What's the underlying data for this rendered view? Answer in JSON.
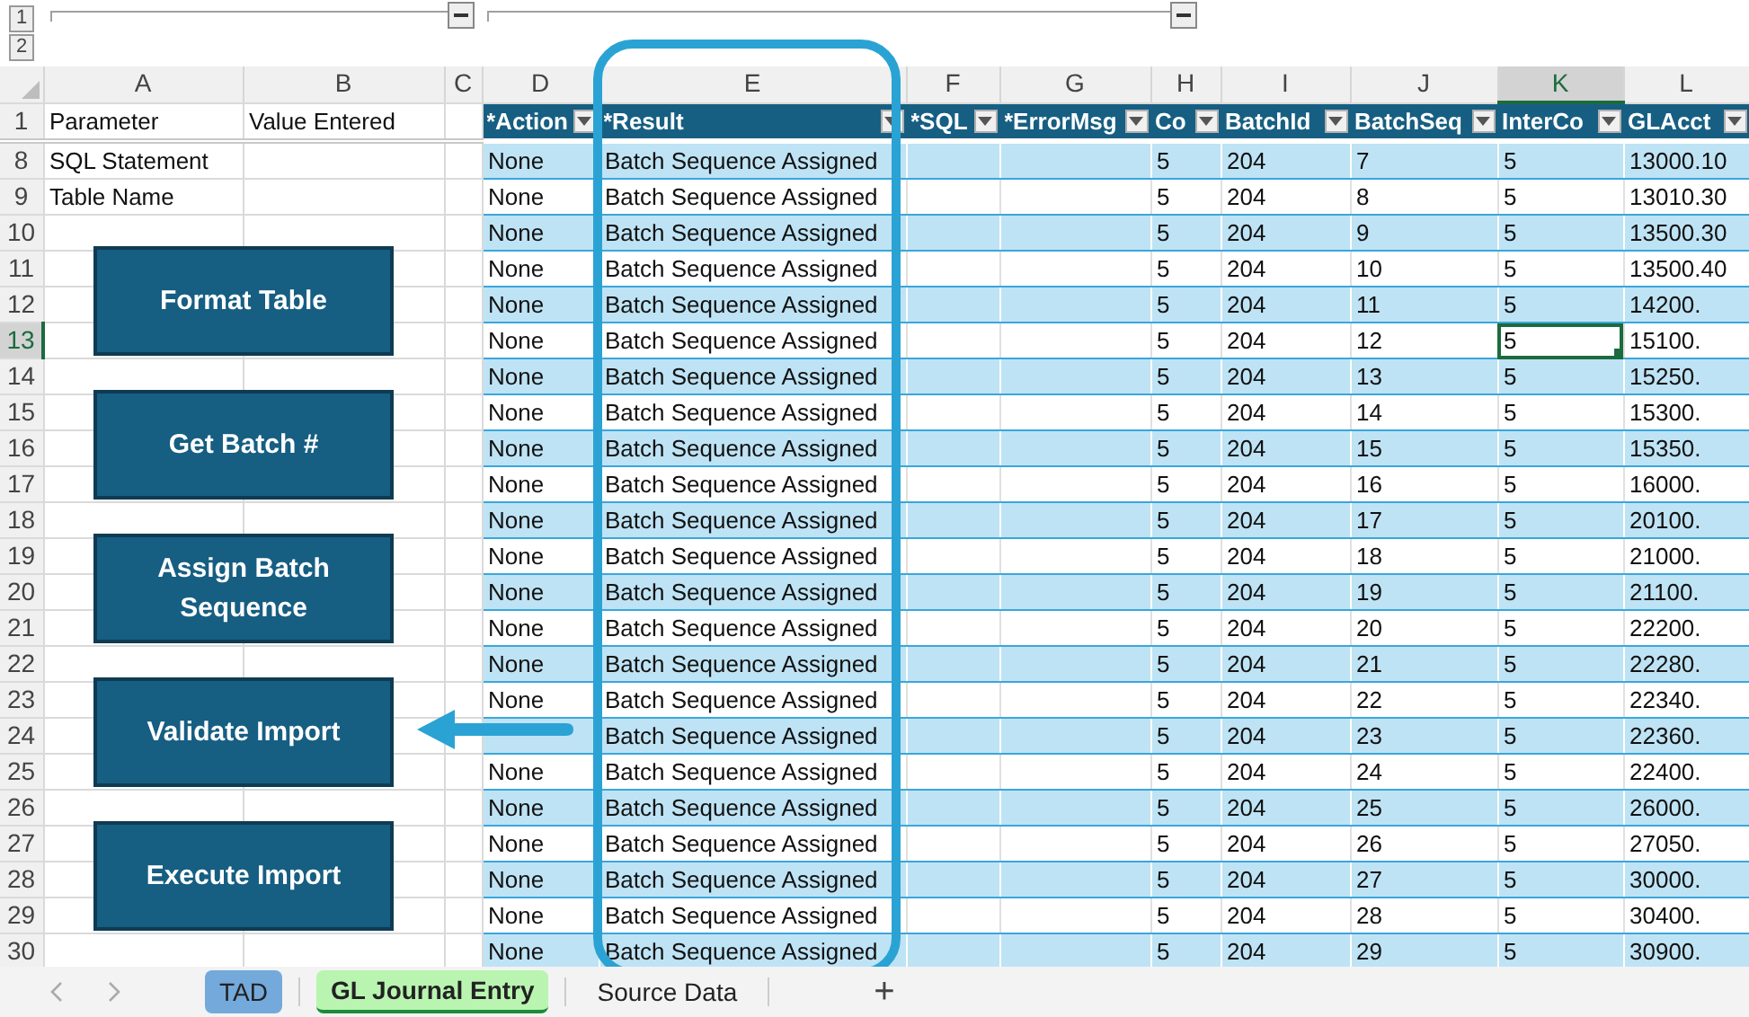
{
  "outline": {
    "levels": [
      "1",
      "2"
    ]
  },
  "columns": [
    {
      "letter": "A",
      "selected": false
    },
    {
      "letter": "B",
      "selected": false
    },
    {
      "letter": "C",
      "selected": false
    },
    {
      "letter": "D",
      "selected": false
    },
    {
      "letter": "E",
      "selected": false
    },
    {
      "letter": "F",
      "selected": false
    },
    {
      "letter": "G",
      "selected": false
    },
    {
      "letter": "H",
      "selected": false
    },
    {
      "letter": "I",
      "selected": false
    },
    {
      "letter": "J",
      "selected": false
    },
    {
      "letter": "K",
      "selected": true
    },
    {
      "letter": "L",
      "selected": false
    }
  ],
  "header_row": {
    "number": "1",
    "parameter": "Parameter",
    "value_label": "Value Entered",
    "headers": [
      "*Action",
      "*Result",
      "*SQL",
      "*ErrorMsg",
      "Co",
      "BatchId",
      "BatchSeq",
      "InterCo",
      "GLAcct"
    ]
  },
  "rows": [
    {
      "number": "8",
      "selected": false,
      "parameter": "SQL Statement",
      "action": "None",
      "result": "Batch Sequence Assigned",
      "co": "5",
      "batch_id": "204",
      "batch_seq": "7",
      "inter_co": "5",
      "gl_acct": "13000.10"
    },
    {
      "number": "9",
      "selected": false,
      "parameter": "Table Name",
      "action": "None",
      "result": "Batch Sequence Assigned",
      "co": "5",
      "batch_id": "204",
      "batch_seq": "8",
      "inter_co": "5",
      "gl_acct": "13010.30"
    },
    {
      "number": "10",
      "selected": false,
      "action": "None",
      "result": "Batch Sequence Assigned",
      "co": "5",
      "batch_id": "204",
      "batch_seq": "9",
      "inter_co": "5",
      "gl_acct": "13500.30"
    },
    {
      "number": "11",
      "selected": false,
      "action": "None",
      "result": "Batch Sequence Assigned",
      "co": "5",
      "batch_id": "204",
      "batch_seq": "10",
      "inter_co": "5",
      "gl_acct": "13500.40"
    },
    {
      "number": "12",
      "selected": false,
      "action": "None",
      "result": "Batch Sequence Assigned",
      "co": "5",
      "batch_id": "204",
      "batch_seq": "11",
      "inter_co": "5",
      "gl_acct": "14200."
    },
    {
      "number": "13",
      "selected": true,
      "action": "None",
      "result": "Batch Sequence Assigned",
      "co": "5",
      "batch_id": "204",
      "batch_seq": "12",
      "inter_co": "5",
      "gl_acct": "15100."
    },
    {
      "number": "14",
      "selected": false,
      "action": "None",
      "result": "Batch Sequence Assigned",
      "co": "5",
      "batch_id": "204",
      "batch_seq": "13",
      "inter_co": "5",
      "gl_acct": "15250."
    },
    {
      "number": "15",
      "selected": false,
      "action": "None",
      "result": "Batch Sequence Assigned",
      "co": "5",
      "batch_id": "204",
      "batch_seq": "14",
      "inter_co": "5",
      "gl_acct": "15300."
    },
    {
      "number": "16",
      "selected": false,
      "action": "None",
      "result": "Batch Sequence Assigned",
      "co": "5",
      "batch_id": "204",
      "batch_seq": "15",
      "inter_co": "5",
      "gl_acct": "15350."
    },
    {
      "number": "17",
      "selected": false,
      "action": "None",
      "result": "Batch Sequence Assigned",
      "co": "5",
      "batch_id": "204",
      "batch_seq": "16",
      "inter_co": "5",
      "gl_acct": "16000."
    },
    {
      "number": "18",
      "selected": false,
      "action": "None",
      "result": "Batch Sequence Assigned",
      "co": "5",
      "batch_id": "204",
      "batch_seq": "17",
      "inter_co": "5",
      "gl_acct": "20100."
    },
    {
      "number": "19",
      "selected": false,
      "action": "None",
      "result": "Batch Sequence Assigned",
      "co": "5",
      "batch_id": "204",
      "batch_seq": "18",
      "inter_co": "5",
      "gl_acct": "21000."
    },
    {
      "number": "20",
      "selected": false,
      "action": "None",
      "result": "Batch Sequence Assigned",
      "co": "5",
      "batch_id": "204",
      "batch_seq": "19",
      "inter_co": "5",
      "gl_acct": "21100."
    },
    {
      "number": "21",
      "selected": false,
      "action": "None",
      "result": "Batch Sequence Assigned",
      "co": "5",
      "batch_id": "204",
      "batch_seq": "20",
      "inter_co": "5",
      "gl_acct": "22200."
    },
    {
      "number": "22",
      "selected": false,
      "action": "None",
      "result": "Batch Sequence Assigned",
      "co": "5",
      "batch_id": "204",
      "batch_seq": "21",
      "inter_co": "5",
      "gl_acct": "22280."
    },
    {
      "number": "23",
      "selected": false,
      "action": "None",
      "result": "Batch Sequence Assigned",
      "co": "5",
      "batch_id": "204",
      "batch_seq": "22",
      "inter_co": "5",
      "gl_acct": "22340."
    },
    {
      "number": "24",
      "selected": false,
      "result": "Batch Sequence Assigned",
      "co": "5",
      "batch_id": "204",
      "batch_seq": "23",
      "inter_co": "5",
      "gl_acct": "22360."
    },
    {
      "number": "25",
      "selected": false,
      "action": "None",
      "result": "Batch Sequence Assigned",
      "co": "5",
      "batch_id": "204",
      "batch_seq": "24",
      "inter_co": "5",
      "gl_acct": "22400."
    },
    {
      "number": "26",
      "selected": false,
      "action": "None",
      "result": "Batch Sequence Assigned",
      "co": "5",
      "batch_id": "204",
      "batch_seq": "25",
      "inter_co": "5",
      "gl_acct": "26000."
    },
    {
      "number": "27",
      "selected": false,
      "action": "None",
      "result": "Batch Sequence Assigned",
      "co": "5",
      "batch_id": "204",
      "batch_seq": "26",
      "inter_co": "5",
      "gl_acct": "27050."
    },
    {
      "number": "28",
      "selected": false,
      "action": "None",
      "result": "Batch Sequence Assigned",
      "co": "5",
      "batch_id": "204",
      "batch_seq": "27",
      "inter_co": "5",
      "gl_acct": "30000."
    },
    {
      "number": "29",
      "selected": false,
      "action": "None",
      "result": "Batch Sequence Assigned",
      "co": "5",
      "batch_id": "204",
      "batch_seq": "28",
      "inter_co": "5",
      "gl_acct": "30400."
    },
    {
      "number": "30",
      "selected": false,
      "action": "None",
      "result": "Batch Sequence Assigned",
      "co": "5",
      "batch_id": "204",
      "batch_seq": "29",
      "inter_co": "5",
      "gl_acct": "30900."
    }
  ],
  "macro_buttons": [
    {
      "label": "Format Table"
    },
    {
      "label": "Get Batch #"
    },
    {
      "label": "Assign Batch Sequence"
    },
    {
      "label": "Validate Import"
    },
    {
      "label": "Execute Import"
    }
  ],
  "sheet_tabs": [
    {
      "label": "TAD",
      "selected": false,
      "color": "#74a9dc"
    },
    {
      "label": "GL Journal Entry",
      "selected": true,
      "color": "#b9f5b0"
    },
    {
      "label": "Source Data",
      "selected": false
    }
  ],
  "add_sheet": "+"
}
